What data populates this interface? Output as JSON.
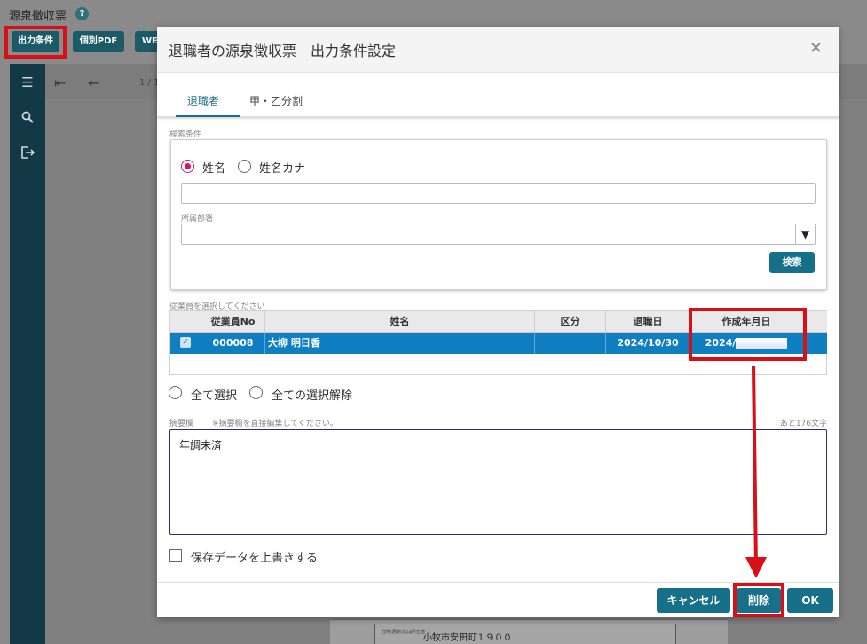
{
  "app": {
    "title": "源泉徴収票",
    "help_glyph": "?",
    "toolbar": {
      "output_conditions": "出力条件",
      "individual_pdf": "個別PDF",
      "web": "WE"
    },
    "page_indicator": "1 / 1"
  },
  "dialog": {
    "title": "退職者の源泉徴収票　出力条件設定",
    "close_glyph": "✕",
    "tabs": [
      {
        "label": "退職者"
      },
      {
        "label": "甲・乙分割"
      }
    ],
    "search": {
      "caption": "検索条件",
      "radio_name": "姓名",
      "radio_kana": "姓名カナ",
      "name_value": "",
      "dept_label": "所属部署",
      "dept_value": "",
      "search_button": "検索"
    },
    "table": {
      "caption": "従業員を選択してください",
      "headers": [
        "従業員No",
        "姓名",
        "区分",
        "退職日",
        "作成年月日"
      ],
      "rows": [
        {
          "checked": "✓",
          "emp_no": "000008",
          "name": "大柳 明日香",
          "category": "",
          "retire_date": "2024/10/30",
          "created_date": "2024/"
        }
      ]
    },
    "select_all": "全て選択",
    "deselect_all": "全ての選択解除",
    "memo": {
      "label": "摘要欄",
      "hint": "※摘要欄を直接編集してください。",
      "remaining": "あと176文字",
      "value": "年調未済"
    },
    "overwrite_label": "保存データを上書きする",
    "buttons": {
      "cancel": "キャンセル",
      "delete": "削除",
      "ok": "OK"
    }
  },
  "background_doc": {
    "address": "小牧市安田町１９００",
    "small_label": "住所(居所)又は所在地"
  },
  "colors": {
    "teal": "#17708a",
    "highlight_red": "#d90f17",
    "selected_row": "#0f7fc2",
    "radio_accent": "#d4166b"
  }
}
